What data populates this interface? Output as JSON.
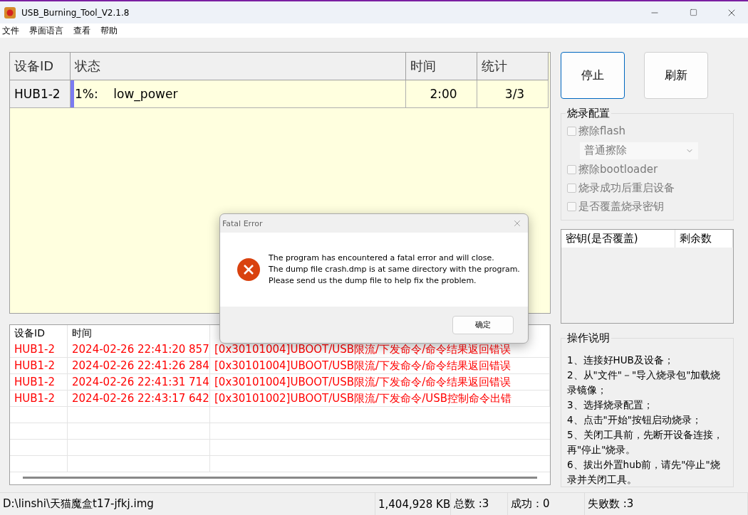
{
  "window": {
    "title": "USB_Burning_Tool_V2.1.8"
  },
  "menu": [
    "文件",
    "界面语言",
    "查看",
    "帮助"
  ],
  "device_table": {
    "columns": [
      "设备ID",
      "状态",
      "时间",
      "统计"
    ],
    "rows": [
      {
        "id": "HUB1-2",
        "status": "1%:    low_power",
        "level": 0.01,
        "time": "2:00",
        "count": "3/3"
      }
    ]
  },
  "buttons": [
    {
      "label": "停止",
      "focused": true
    },
    {
      "label": "刷新",
      "focused": false
    }
  ],
  "burn_config": {
    "title": "烧录配置",
    "options": [
      {
        "kind": "checkbox",
        "label": "擦除flash",
        "checked": false,
        "disabled": true
      },
      {
        "kind": "dropdown",
        "value": "普通擦除",
        "disabled": true
      },
      {
        "kind": "checkbox",
        "label": "擦除bootloader",
        "checked": false,
        "disabled": true
      },
      {
        "kind": "checkbox",
        "label": "烧录成功后重启设备",
        "checked": false,
        "disabled": true
      },
      {
        "kind": "checkbox",
        "label": "是否覆盖烧录密钥",
        "checked": false,
        "disabled": true
      }
    ]
  },
  "key_table": {
    "columns": [
      "密钥(是否覆盖)",
      "剩余数"
    ]
  },
  "log_table": {
    "columns": [
      "设备ID",
      "时间"
    ],
    "rows": [
      {
        "device": "HUB1-2",
        "time": "2024-02-26 22:41:20 857",
        "message": "[0x30101004]UBOOT/USB限流/下发命令/命令结果返回错误",
        "color": "#ff0000"
      },
      {
        "device": "HUB1-2",
        "time": "2024-02-26 22:41:26 284",
        "message": "[0x30101004]UBOOT/USB限流/下发命令/命令结果返回错误",
        "color": "#ff0000"
      },
      {
        "device": "HUB1-2",
        "time": "2024-02-26 22:41:31 714",
        "message": "[0x30101004]UBOOT/USB限流/下发命令/命令结果返回错误",
        "color": "#ff0000"
      },
      {
        "device": "HUB1-2",
        "time": "2024-02-26 22:43:17 642",
        "message": "[0x30101002]UBOOT/USB限流/下发命令/USB控制命令出错",
        "color": "#ff0000"
      }
    ]
  },
  "instructions": {
    "title": "操作说明",
    "lines": [
      "1、连接好HUB及设备；",
      "2、从\"文件\"－\"导入烧录包\"加载烧录镜像；",
      "3、选择烧录配置；",
      "4、点击\"开始\"按钮启动烧录；",
      "5、关闭工具前，先断开设备连接，再\"停止\"烧录。",
      "6、拔出外置hub前，请先\"停止\"烧录并关闭工具。"
    ]
  },
  "status_bar": [
    "D:\\linshi\\天猫魔盒t17-jfkj.img",
    "1,404,928 KB",
    "总数 :3",
    "成功：0",
    "失败数 :3"
  ],
  "dialog": {
    "title": "Fatal Error",
    "lines": [
      "The program has encountered a fatal error and will close.",
      "The dump file crash.dmp is at same directory with the program.",
      "Please send us the dump file to help fix the problem."
    ],
    "button": "确定"
  }
}
